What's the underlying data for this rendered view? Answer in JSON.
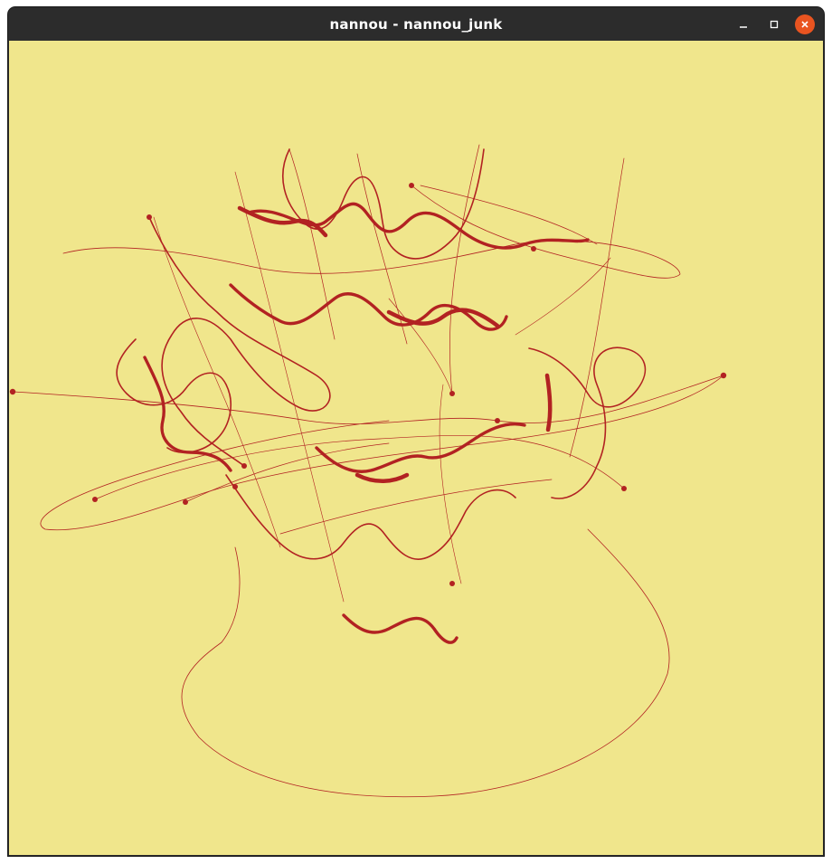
{
  "window": {
    "title": "nannou - nannou_junk"
  },
  "controls": {
    "minimize_icon": "minimize-icon",
    "maximize_icon": "maximize-icon",
    "close_icon": "close-icon"
  },
  "canvas": {
    "background_color": "#f0e68c",
    "stroke_color": "#b22222"
  }
}
